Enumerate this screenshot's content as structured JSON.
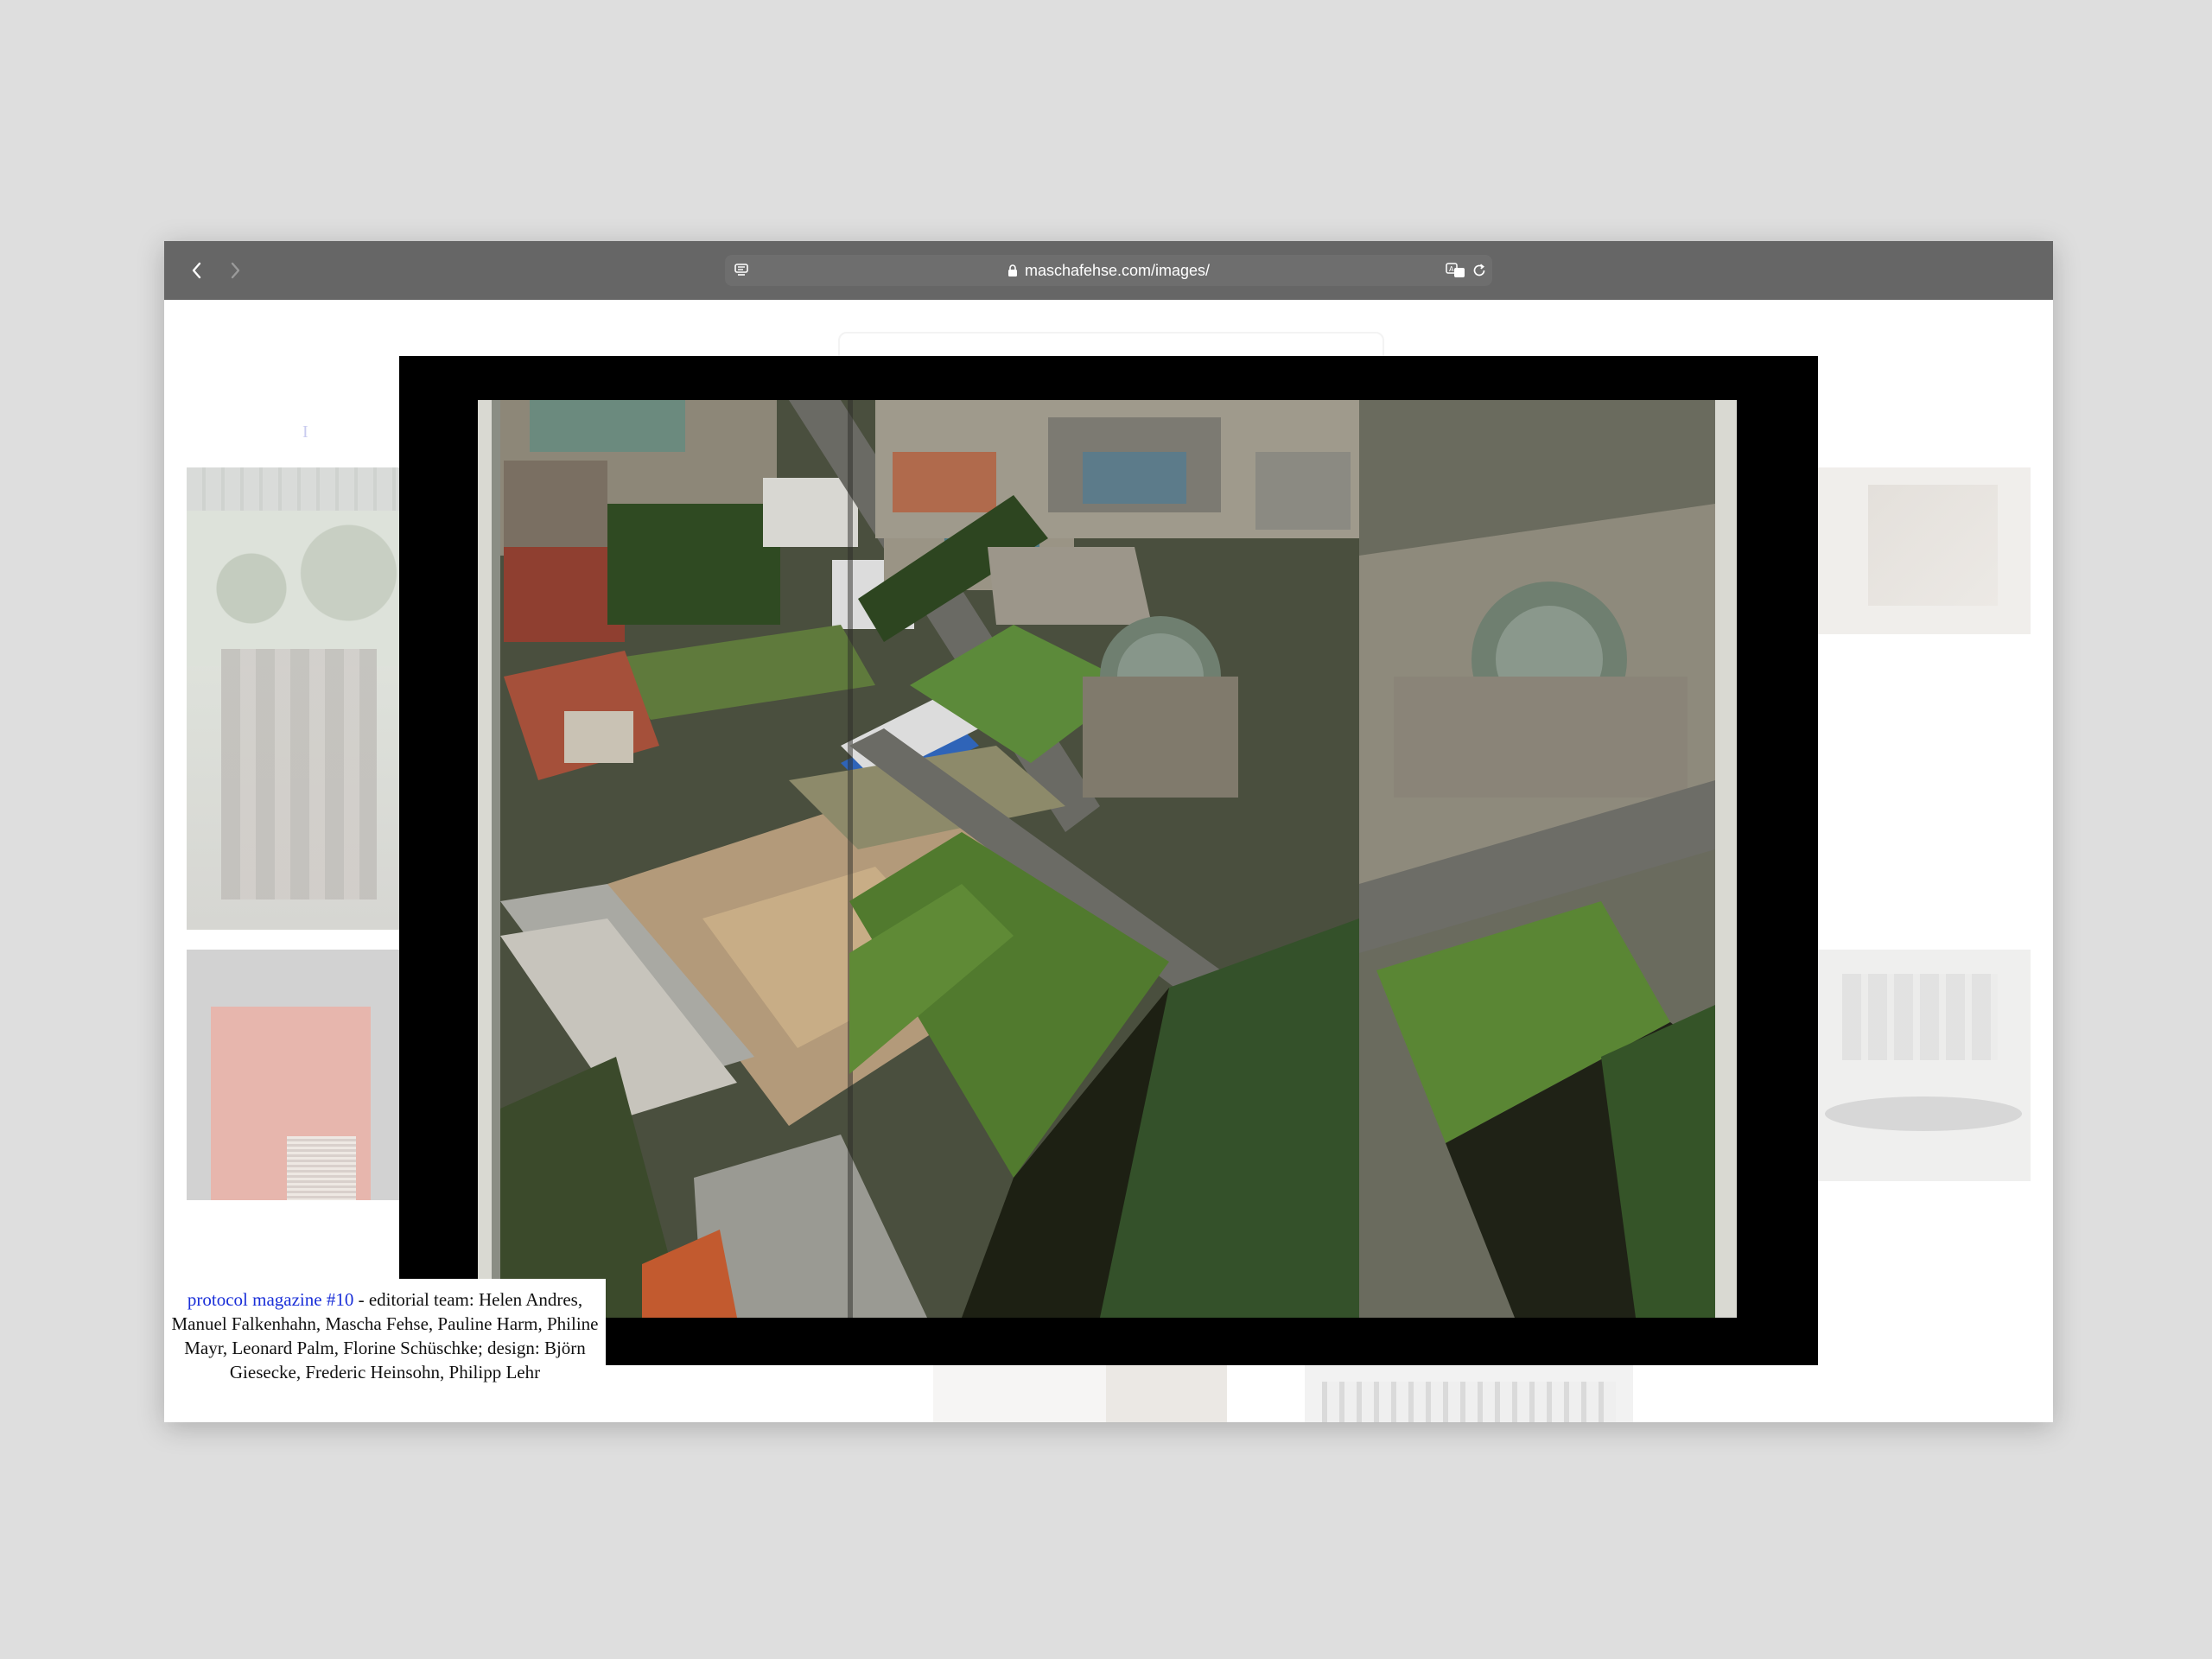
{
  "browser": {
    "url": "maschafehse.com/images/",
    "back_icon": "chevron-left-icon",
    "forward_icon": "chevron-right-icon",
    "reader_icon": "reader-mode-icon",
    "lock_icon": "lock-icon",
    "translate_icon": "translate-icon",
    "reload_icon": "reload-icon"
  },
  "background_page": {
    "link_fragment": "I"
  },
  "lightbox": {
    "image_label": "aerial city photo spread"
  },
  "caption": {
    "link_text": "protocol magazine #10",
    "description": " - editorial team: Helen Andres, Manuel Falkenhahn, Mascha Fehse, Pauline Harm, Philine Mayr, Leonard Palm, Florine Schüschke; design: Björn Giesecke, Frederic Heinsohn, Philipp Lehr"
  },
  "colors": {
    "page_background": "#dedede",
    "toolbar": "#666666",
    "link": "#1a2fd8",
    "lightbox_backdrop": "#000000"
  }
}
